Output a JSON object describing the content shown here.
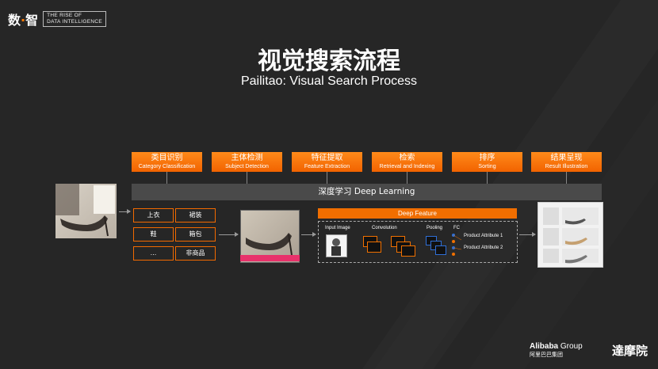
{
  "header": {
    "logo_zh_1": "数",
    "logo_zh_dot": "·",
    "logo_zh_2": "智",
    "logo_en_line1": "THE RISE OF",
    "logo_en_line2": "DATA INTELLIGENCE"
  },
  "title_zh": "视觉搜索流程",
  "title_en": "Pailitao: Visual Search Process",
  "steps": [
    {
      "zh": "类目识别",
      "en": "Category Classification"
    },
    {
      "zh": "主体检测",
      "en": "Subject Detection"
    },
    {
      "zh": "特征提取",
      "en": "Feature Extraction"
    },
    {
      "zh": "检索",
      "en": "Retrieval and Indexing"
    },
    {
      "zh": "排序",
      "en": "Sorting"
    },
    {
      "zh": "结果呈现",
      "en": "Result Illustration"
    }
  ],
  "deep_learning_label": "深度学习 Deep Learning",
  "categories": [
    "上衣",
    "裙装",
    "鞋",
    "箱包",
    "...",
    "非商品"
  ],
  "deep_feature": {
    "title": "Deep Feature",
    "input_image": "Input Image",
    "convolution": "Convolution",
    "pooling": "Pooling",
    "fc": "FC",
    "attr1": "Product  Attribute 1",
    "attr2": "Product  Attribute 2"
  },
  "footer": {
    "alibaba": "Alibaba",
    "group": "Group",
    "alibaba_cn": "阿里巴巴集团",
    "damo": "達摩院"
  },
  "colors": {
    "accent": "#f26a00",
    "background": "#262626",
    "pink": "#e8316b"
  }
}
